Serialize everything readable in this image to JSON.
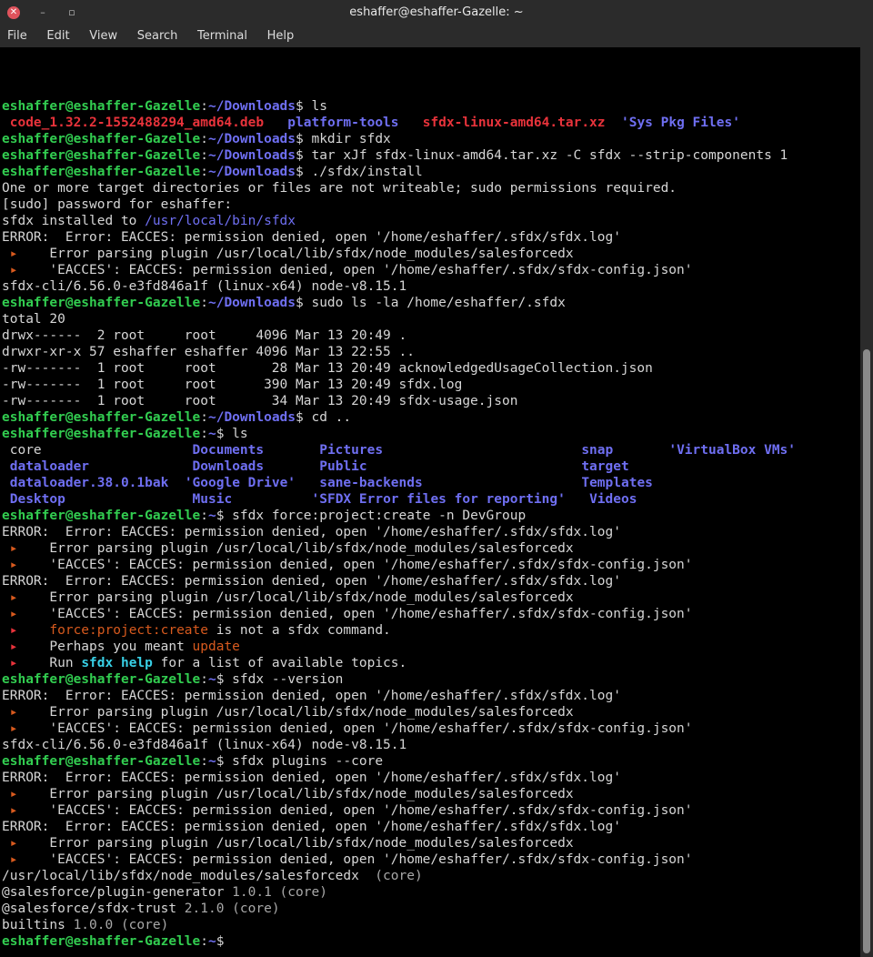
{
  "window": {
    "title": "eshaffer@eshaffer-Gazelle: ~",
    "close_glyph": "✕",
    "min_glyph": "–",
    "max_glyph": "▫"
  },
  "menu": [
    "File",
    "Edit",
    "View",
    "Search",
    "Terminal",
    "Help"
  ],
  "colors": {
    "bg": "#000000",
    "fg": "#d6d6d6",
    "user": "#32cd50",
    "path": "#6f6ff2",
    "deb": "#e8333b",
    "dir": "#6f6ff2",
    "warn": "#d85a1e",
    "muted": "#a9a9a9",
    "cyan": "#38d0e6",
    "scroll_thumb": "#8a8a8a"
  },
  "terminal": {
    "lines": [
      [
        {
          "t": "eshaffer@eshaffer-Gazelle",
          "c": "user",
          "b": 1
        },
        {
          "t": ":"
        },
        {
          "t": "~/Downloads",
          "c": "path",
          "b": 1
        },
        {
          "t": "$ ls"
        }
      ],
      [
        {
          "t": " "
        },
        {
          "t": "code_1.32.2-1552488294_amd64.deb",
          "c": "deb",
          "b": 1
        },
        {
          "t": "   "
        },
        {
          "t": "platform-tools",
          "c": "dir",
          "b": 1
        },
        {
          "t": "   "
        },
        {
          "t": "sfdx-linux-amd64.tar.xz",
          "c": "deb",
          "b": 1
        },
        {
          "t": "  "
        },
        {
          "t": "'Sys Pkg Files'",
          "c": "dir",
          "b": 1
        }
      ],
      [
        {
          "t": "eshaffer@eshaffer-Gazelle",
          "c": "user",
          "b": 1
        },
        {
          "t": ":"
        },
        {
          "t": "~/Downloads",
          "c": "path",
          "b": 1
        },
        {
          "t": "$ mkdir sfdx"
        }
      ],
      [
        {
          "t": "eshaffer@eshaffer-Gazelle",
          "c": "user",
          "b": 1
        },
        {
          "t": ":"
        },
        {
          "t": "~/Downloads",
          "c": "path",
          "b": 1
        },
        {
          "t": "$ tar xJf sfdx-linux-amd64.tar.xz -C sfdx --strip-components 1"
        }
      ],
      [
        {
          "t": "eshaffer@eshaffer-Gazelle",
          "c": "user",
          "b": 1
        },
        {
          "t": ":"
        },
        {
          "t": "~/Downloads",
          "c": "path",
          "b": 1
        },
        {
          "t": "$ ./sfdx/install"
        }
      ],
      [
        {
          "t": "One or more target directories or files are not writeable; sudo permissions required."
        }
      ],
      [
        {
          "t": "[sudo] password for eshaffer:"
        }
      ],
      [
        {
          "t": "sfdx installed to "
        },
        {
          "t": "/usr/local/bin/sfdx",
          "c": "path"
        }
      ],
      [
        {
          "t": "ERROR:  Error: EACCES: permission denied, open '/home/eshaffer/.sfdx/sfdx.log'"
        }
      ],
      [
        {
          "t": " ▸",
          "c": "warn"
        },
        {
          "t": "    Error parsing plugin /usr/local/lib/sfdx/node_modules/salesforcedx"
        }
      ],
      [
        {
          "t": " ▸",
          "c": "warn"
        },
        {
          "t": "    'EACCES': EACCES: permission denied, open '/home/eshaffer/.sfdx/sfdx-config.json'"
        }
      ],
      [
        {
          "t": "sfdx-cli/6.56.0-e3fd846a1f (linux-x64) node-v8.15.1"
        }
      ],
      [
        {
          "t": "eshaffer@eshaffer-Gazelle",
          "c": "user",
          "b": 1
        },
        {
          "t": ":"
        },
        {
          "t": "~/Downloads",
          "c": "path",
          "b": 1
        },
        {
          "t": "$ sudo ls -la /home/eshaffer/.sfdx"
        }
      ],
      [
        {
          "t": "total 20"
        }
      ],
      [
        {
          "t": "drwx------  2 root     root     4096 Mar 13 20:49 ."
        }
      ],
      [
        {
          "t": "drwxr-xr-x 57 eshaffer eshaffer 4096 Mar 13 22:55 .."
        }
      ],
      [
        {
          "t": "-rw-------  1 root     root       28 Mar 13 20:49 acknowledgedUsageCollection.json"
        }
      ],
      [
        {
          "t": "-rw-------  1 root     root      390 Mar 13 20:49 sfdx.log"
        }
      ],
      [
        {
          "t": "-rw-------  1 root     root       34 Mar 13 20:49 sfdx-usage.json"
        }
      ],
      [
        {
          "t": "eshaffer@eshaffer-Gazelle",
          "c": "user",
          "b": 1
        },
        {
          "t": ":"
        },
        {
          "t": "~/Downloads",
          "c": "path",
          "b": 1
        },
        {
          "t": "$ cd .."
        }
      ],
      [
        {
          "t": "eshaffer@eshaffer-Gazelle",
          "c": "user",
          "b": 1
        },
        {
          "t": ":"
        },
        {
          "t": "~",
          "c": "path",
          "b": 1
        },
        {
          "t": "$ ls"
        }
      ],
      [
        {
          "t": " "
        },
        {
          "t": "core",
          "c": "fg"
        },
        {
          "t": "                   "
        },
        {
          "t": "Documents",
          "c": "dir",
          "b": 1
        },
        {
          "t": "       "
        },
        {
          "t": "Pictures",
          "c": "dir",
          "b": 1
        },
        {
          "t": "                         "
        },
        {
          "t": "snap",
          "c": "dir",
          "b": 1
        },
        {
          "t": "       "
        },
        {
          "t": "'VirtualBox VMs'",
          "c": "dir",
          "b": 1
        }
      ],
      [
        {
          "t": " "
        },
        {
          "t": "dataloader",
          "c": "dir",
          "b": 1
        },
        {
          "t": "             "
        },
        {
          "t": "Downloads",
          "c": "dir",
          "b": 1
        },
        {
          "t": "       "
        },
        {
          "t": "Public",
          "c": "dir",
          "b": 1
        },
        {
          "t": "                           "
        },
        {
          "t": "target",
          "c": "dir",
          "b": 1
        }
      ],
      [
        {
          "t": " "
        },
        {
          "t": "dataloader.38.0.1bak",
          "c": "dir",
          "b": 1
        },
        {
          "t": "  "
        },
        {
          "t": "'Google Drive'",
          "c": "dir",
          "b": 1
        },
        {
          "t": "   "
        },
        {
          "t": "sane-backends",
          "c": "dir",
          "b": 1
        },
        {
          "t": "                    "
        },
        {
          "t": "Templates",
          "c": "dir",
          "b": 1
        }
      ],
      [
        {
          "t": " "
        },
        {
          "t": "Desktop",
          "c": "dir",
          "b": 1
        },
        {
          "t": "                "
        },
        {
          "t": "Music",
          "c": "dir",
          "b": 1
        },
        {
          "t": "          "
        },
        {
          "t": "'SFDX Error files for reporting'",
          "c": "dir",
          "b": 1
        },
        {
          "t": "   "
        },
        {
          "t": "Videos",
          "c": "dir",
          "b": 1
        }
      ],
      [
        {
          "t": "eshaffer@eshaffer-Gazelle",
          "c": "user",
          "b": 1
        },
        {
          "t": ":"
        },
        {
          "t": "~",
          "c": "path",
          "b": 1
        },
        {
          "t": "$ sfdx force:project:create -n DevGroup"
        }
      ],
      [
        {
          "t": "ERROR:  Error: EACCES: permission denied, open '/home/eshaffer/.sfdx/sfdx.log'"
        }
      ],
      [
        {
          "t": " ▸",
          "c": "warn"
        },
        {
          "t": "    Error parsing plugin /usr/local/lib/sfdx/node_modules/salesforcedx"
        }
      ],
      [
        {
          "t": " ▸",
          "c": "warn"
        },
        {
          "t": "    'EACCES': EACCES: permission denied, open '/home/eshaffer/.sfdx/sfdx-config.json'"
        }
      ],
      [
        {
          "t": "ERROR:  Error: EACCES: permission denied, open '/home/eshaffer/.sfdx/sfdx.log'"
        }
      ],
      [
        {
          "t": " ▸",
          "c": "warn"
        },
        {
          "t": "    Error parsing plugin /usr/local/lib/sfdx/node_modules/salesforcedx"
        }
      ],
      [
        {
          "t": " ▸",
          "c": "warn"
        },
        {
          "t": "    'EACCES': EACCES: permission denied, open '/home/eshaffer/.sfdx/sfdx-config.json'"
        }
      ],
      [
        {
          "t": " ▸",
          "c": "deb"
        },
        {
          "t": "    "
        },
        {
          "t": "force:project:create",
          "c": "warn"
        },
        {
          "t": " is not a sfdx command."
        }
      ],
      [
        {
          "t": " ▸",
          "c": "deb"
        },
        {
          "t": "    Perhaps you meant "
        },
        {
          "t": "update",
          "c": "warn"
        }
      ],
      [
        {
          "t": " ▸",
          "c": "deb"
        },
        {
          "t": "    Run "
        },
        {
          "t": "sfdx help",
          "c": "cyan",
          "b": 1
        },
        {
          "t": " for a list of available topics."
        }
      ],
      [
        {
          "t": "eshaffer@eshaffer-Gazelle",
          "c": "user",
          "b": 1
        },
        {
          "t": ":"
        },
        {
          "t": "~",
          "c": "path",
          "b": 1
        },
        {
          "t": "$ sfdx --version"
        }
      ],
      [
        {
          "t": "ERROR:  Error: EACCES: permission denied, open '/home/eshaffer/.sfdx/sfdx.log'"
        }
      ],
      [
        {
          "t": " ▸",
          "c": "warn"
        },
        {
          "t": "    Error parsing plugin /usr/local/lib/sfdx/node_modules/salesforcedx"
        }
      ],
      [
        {
          "t": " ▸",
          "c": "warn"
        },
        {
          "t": "    'EACCES': EACCES: permission denied, open '/home/eshaffer/.sfdx/sfdx-config.json'"
        }
      ],
      [
        {
          "t": "sfdx-cli/6.56.0-e3fd846a1f (linux-x64) node-v8.15.1"
        }
      ],
      [
        {
          "t": "eshaffer@eshaffer-Gazelle",
          "c": "user",
          "b": 1
        },
        {
          "t": ":"
        },
        {
          "t": "~",
          "c": "path",
          "b": 1
        },
        {
          "t": "$ sfdx plugins --core"
        }
      ],
      [
        {
          "t": "ERROR:  Error: EACCES: permission denied, open '/home/eshaffer/.sfdx/sfdx.log'"
        }
      ],
      [
        {
          "t": " ▸",
          "c": "warn"
        },
        {
          "t": "    Error parsing plugin /usr/local/lib/sfdx/node_modules/salesforcedx"
        }
      ],
      [
        {
          "t": " ▸",
          "c": "warn"
        },
        {
          "t": "    'EACCES': EACCES: permission denied, open '/home/eshaffer/.sfdx/sfdx-config.json'"
        }
      ],
      [
        {
          "t": "ERROR:  Error: EACCES: permission denied, open '/home/eshaffer/.sfdx/sfdx.log'"
        }
      ],
      [
        {
          "t": " ▸",
          "c": "warn"
        },
        {
          "t": "    Error parsing plugin /usr/local/lib/sfdx/node_modules/salesforcedx"
        }
      ],
      [
        {
          "t": " ▸",
          "c": "warn"
        },
        {
          "t": "    'EACCES': EACCES: permission denied, open '/home/eshaffer/.sfdx/sfdx-config.json'"
        }
      ],
      [
        {
          "t": "/usr/local/lib/sfdx/node_modules/salesforcedx "
        },
        {
          "t": " (core)",
          "c": "muted"
        }
      ],
      [
        {
          "t": "@salesforce/plugin-generator "
        },
        {
          "t": "1.0.1 (core)",
          "c": "muted"
        }
      ],
      [
        {
          "t": "@salesforce/sfdx-trust "
        },
        {
          "t": "2.1.0 (core)",
          "c": "muted"
        }
      ],
      [
        {
          "t": "builtins "
        },
        {
          "t": "1.0.0 (core)",
          "c": "muted"
        }
      ],
      [
        {
          "t": "eshaffer@eshaffer-Gazelle",
          "c": "user",
          "b": 1
        },
        {
          "t": ":"
        },
        {
          "t": "~",
          "c": "path",
          "b": 1
        },
        {
          "t": "$"
        }
      ]
    ]
  }
}
